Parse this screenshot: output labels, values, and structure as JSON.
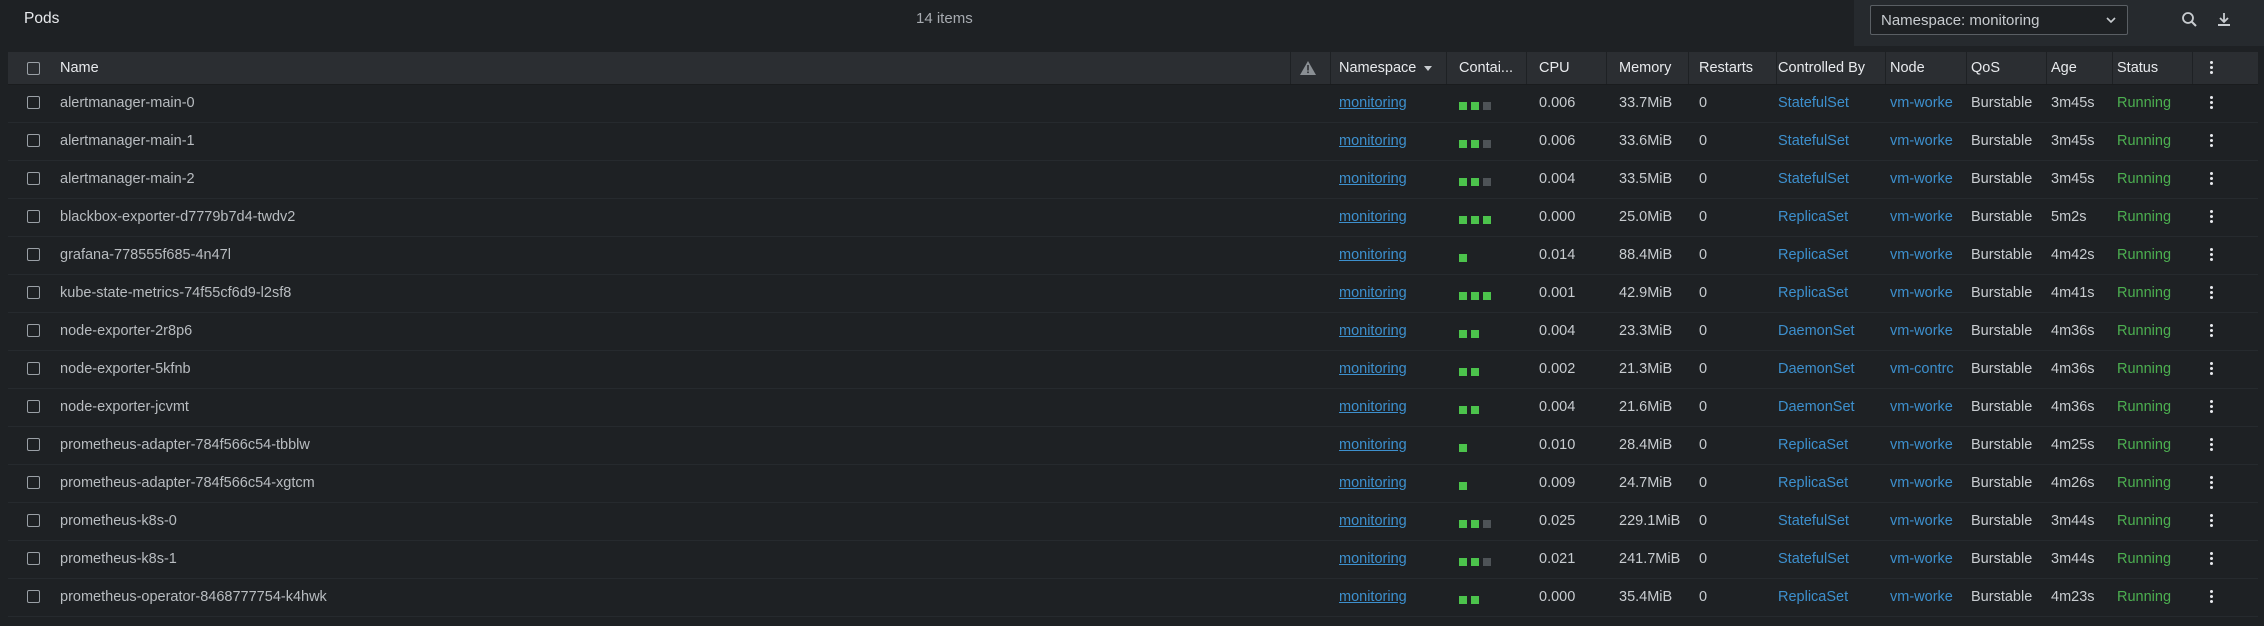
{
  "header": {
    "title": "Pods",
    "item_count": "14 items",
    "namespace_select": "Namespace: monitoring"
  },
  "columns": {
    "name": "Name",
    "namespace": "Namespace",
    "containers": "Contai...",
    "cpu": "CPU",
    "memory": "Memory",
    "restarts": "Restarts",
    "controlled_by": "Controlled By",
    "node": "Node",
    "qos": "QoS",
    "age": "Age",
    "status": "Status"
  },
  "rows": [
    {
      "name": "alertmanager-main-0",
      "namespace": "monitoring",
      "containers": [
        1,
        1,
        0
      ],
      "cpu": "0.006",
      "memory": "33.7MiB",
      "restarts": "0",
      "controlled_by": "StatefulSet",
      "node": "vm-worke",
      "qos": "Burstable",
      "age": "3m45s",
      "status": "Running"
    },
    {
      "name": "alertmanager-main-1",
      "namespace": "monitoring",
      "containers": [
        1,
        1,
        0
      ],
      "cpu": "0.006",
      "memory": "33.6MiB",
      "restarts": "0",
      "controlled_by": "StatefulSet",
      "node": "vm-worke",
      "qos": "Burstable",
      "age": "3m45s",
      "status": "Running"
    },
    {
      "name": "alertmanager-main-2",
      "namespace": "monitoring",
      "containers": [
        1,
        1,
        0
      ],
      "cpu": "0.004",
      "memory": "33.5MiB",
      "restarts": "0",
      "controlled_by": "StatefulSet",
      "node": "vm-worke",
      "qos": "Burstable",
      "age": "3m45s",
      "status": "Running"
    },
    {
      "name": "blackbox-exporter-d7779b7d4-twdv2",
      "namespace": "monitoring",
      "containers": [
        1,
        1,
        1
      ],
      "cpu": "0.000",
      "memory": "25.0MiB",
      "restarts": "0",
      "controlled_by": "ReplicaSet",
      "node": "vm-worke",
      "qos": "Burstable",
      "age": "5m2s",
      "status": "Running"
    },
    {
      "name": "grafana-778555f685-4n47l",
      "namespace": "monitoring",
      "containers": [
        1
      ],
      "cpu": "0.014",
      "memory": "88.4MiB",
      "restarts": "0",
      "controlled_by": "ReplicaSet",
      "node": "vm-worke",
      "qos": "Burstable",
      "age": "4m42s",
      "status": "Running"
    },
    {
      "name": "kube-state-metrics-74f55cf6d9-l2sf8",
      "namespace": "monitoring",
      "containers": [
        1,
        1,
        1
      ],
      "cpu": "0.001",
      "memory": "42.9MiB",
      "restarts": "0",
      "controlled_by": "ReplicaSet",
      "node": "vm-worke",
      "qos": "Burstable",
      "age": "4m41s",
      "status": "Running"
    },
    {
      "name": "node-exporter-2r8p6",
      "namespace": "monitoring",
      "containers": [
        1,
        1
      ],
      "cpu": "0.004",
      "memory": "23.3MiB",
      "restarts": "0",
      "controlled_by": "DaemonSet",
      "node": "vm-worke",
      "qos": "Burstable",
      "age": "4m36s",
      "status": "Running"
    },
    {
      "name": "node-exporter-5kfnb",
      "namespace": "monitoring",
      "containers": [
        1,
        1
      ],
      "cpu": "0.002",
      "memory": "21.3MiB",
      "restarts": "0",
      "controlled_by": "DaemonSet",
      "node": "vm-contrc",
      "qos": "Burstable",
      "age": "4m36s",
      "status": "Running"
    },
    {
      "name": "node-exporter-jcvmt",
      "namespace": "monitoring",
      "containers": [
        1,
        1
      ],
      "cpu": "0.004",
      "memory": "21.6MiB",
      "restarts": "0",
      "controlled_by": "DaemonSet",
      "node": "vm-worke",
      "qos": "Burstable",
      "age": "4m36s",
      "status": "Running"
    },
    {
      "name": "prometheus-adapter-784f566c54-tbblw",
      "namespace": "monitoring",
      "containers": [
        1
      ],
      "cpu": "0.010",
      "memory": "28.4MiB",
      "restarts": "0",
      "controlled_by": "ReplicaSet",
      "node": "vm-worke",
      "qos": "Burstable",
      "age": "4m25s",
      "status": "Running"
    },
    {
      "name": "prometheus-adapter-784f566c54-xgtcm",
      "namespace": "monitoring",
      "containers": [
        1
      ],
      "cpu": "0.009",
      "memory": "24.7MiB",
      "restarts": "0",
      "controlled_by": "ReplicaSet",
      "node": "vm-worke",
      "qos": "Burstable",
      "age": "4m26s",
      "status": "Running"
    },
    {
      "name": "prometheus-k8s-0",
      "namespace": "monitoring",
      "containers": [
        1,
        1,
        0
      ],
      "cpu": "0.025",
      "memory": "229.1MiB",
      "restarts": "0",
      "controlled_by": "StatefulSet",
      "node": "vm-worke",
      "qos": "Burstable",
      "age": "3m44s",
      "status": "Running"
    },
    {
      "name": "prometheus-k8s-1",
      "namespace": "monitoring",
      "containers": [
        1,
        1,
        0
      ],
      "cpu": "0.021",
      "memory": "241.7MiB",
      "restarts": "0",
      "controlled_by": "StatefulSet",
      "node": "vm-worke",
      "qos": "Burstable",
      "age": "3m44s",
      "status": "Running"
    },
    {
      "name": "prometheus-operator-8468777754-k4hwk",
      "namespace": "monitoring",
      "containers": [
        1,
        1
      ],
      "cpu": "0.000",
      "memory": "35.4MiB",
      "restarts": "0",
      "controlled_by": "ReplicaSet",
      "node": "vm-worke",
      "qos": "Burstable",
      "age": "4m23s",
      "status": "Running"
    }
  ],
  "colors": {
    "running": "#4caf50",
    "link": "#3d90ce",
    "container_ready": "#4cc34c",
    "container_idle": "#4e5357"
  },
  "icons": [
    "chevron-down-icon",
    "search-icon",
    "download-icon",
    "warning-icon",
    "kebab-menu-icon"
  ]
}
